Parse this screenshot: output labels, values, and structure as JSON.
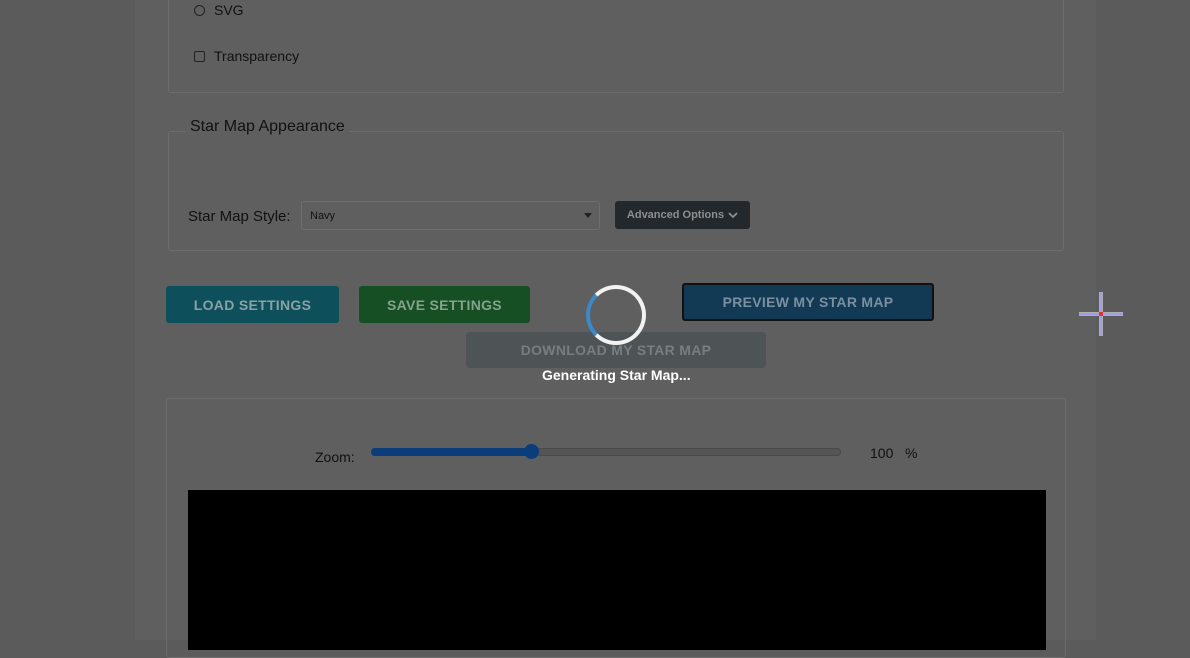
{
  "format_options": {
    "svg_label": "SVG",
    "transparency_label": "Transparency"
  },
  "appearance": {
    "legend": "Star Map Appearance",
    "style_label": "Star Map Style:",
    "style_value": "Navy",
    "advanced_label": "Advanced Options"
  },
  "actions": {
    "load": "LOAD SETTINGS",
    "save": "SAVE SETTINGS",
    "preview": "PREVIEW MY STAR MAP",
    "download": "DOWNLOAD MY STAR MAP"
  },
  "preview": {
    "zoom_label": "Zoom:",
    "zoom_value": "100",
    "zoom_unit": "%",
    "zoom_slider_fraction": 0.34
  },
  "overlay": {
    "loading_text": "Generating Star Map..."
  },
  "icons": {
    "advanced_chevron": "chevron-down-icon",
    "select_arrow": "caret-down-icon",
    "spinner": "loading-spinner-icon",
    "cursor": "crosshair-cursor-icon"
  },
  "colors": {
    "load_button": "#17a2b8",
    "save_button": "#28a745",
    "preview_button": "#1f6fa8",
    "slider": "#0d6efd"
  }
}
